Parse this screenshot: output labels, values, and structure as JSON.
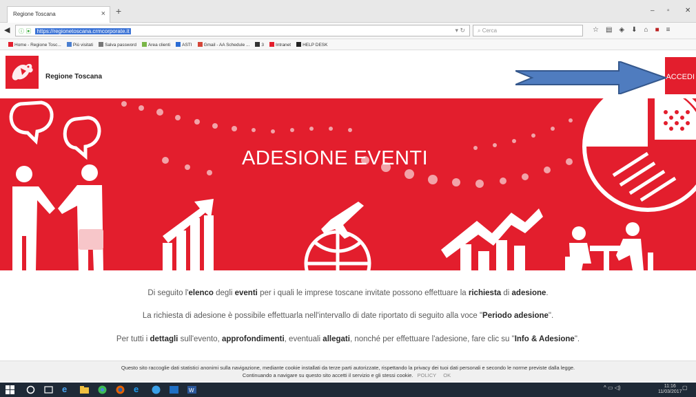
{
  "browser": {
    "tab_title": "Regione Toscana",
    "tab_close": "×",
    "new_tab": "+",
    "url": "https://regionetoscana.crmcorporate.it",
    "search_placeholder": "Cerca",
    "window_controls": [
      "–",
      "▫",
      "✕"
    ]
  },
  "bookmarks": [
    {
      "label": "Home - Regione Tosc...",
      "icon": "regione-icon",
      "color": "#e31e2d"
    },
    {
      "label": "Più visitati",
      "icon": "star-icon",
      "color": "#4a7fd0"
    },
    {
      "label": "Salva password",
      "icon": "gear-icon",
      "color": "#777777"
    },
    {
      "label": "Area clienti",
      "icon": "leaf-icon",
      "color": "#7ab648"
    },
    {
      "label": "ASTI",
      "icon": "page-icon",
      "color": "#2b6cd4"
    },
    {
      "label": "Gmail - AA Schedule ...",
      "icon": "gmail-icon",
      "color": "#d44638"
    },
    {
      "label": "3",
      "icon": "wb-icon",
      "color": "#333333"
    },
    {
      "label": "Intranet",
      "icon": "rt-icon",
      "color": "#e31e2d"
    },
    {
      "label": "HELP DESK",
      "icon": "helpdesk-icon",
      "color": "#222222"
    }
  ],
  "site": {
    "brand": "Regione Toscana",
    "login_label": "ACCEDI",
    "hero_title": "ADESIONE EVENTI",
    "accent_color": "#e31e2d"
  },
  "intro": {
    "line1": {
      "a": "Di seguito l'",
      "b1": "elenco",
      "c": " degli ",
      "b2": "eventi",
      "d": " per i quali le imprese toscane invitate possono effettuare la ",
      "b3": "richiesta",
      "e": " di ",
      "b4": "adesione",
      "f": "."
    },
    "line2": {
      "a": "La richiesta di adesione è possibile effettuarla nell'intervallo di date riportato di seguito alla voce \"",
      "b1": "Periodo adesione",
      "c": "\"."
    },
    "line3": {
      "a": "Per tutti i ",
      "b1": "dettagli",
      "c": " sull'evento, ",
      "b2": "approfondimenti",
      "d": ", eventuali ",
      "b3": "allegati",
      "e": ", nonché per effettuare l'adesione, fare clic su \"",
      "b4": "Info & Adesione",
      "f": "\"."
    }
  },
  "cookie": {
    "line1": "Questo sito raccoglie dati statistici anonimi sulla navigazione, mediante cookie installati da terze parti autorizzate, rispettando la privacy dei tuoi dati personali e secondo le norme previste dalla legge.",
    "line2": "Continuando a navigare su questo sito accetti il servizio e gli stessi cookie.",
    "policy": "POLICY",
    "ok": "OK"
  },
  "taskbar": {
    "time": "11:16",
    "date": "11/03/2017"
  }
}
